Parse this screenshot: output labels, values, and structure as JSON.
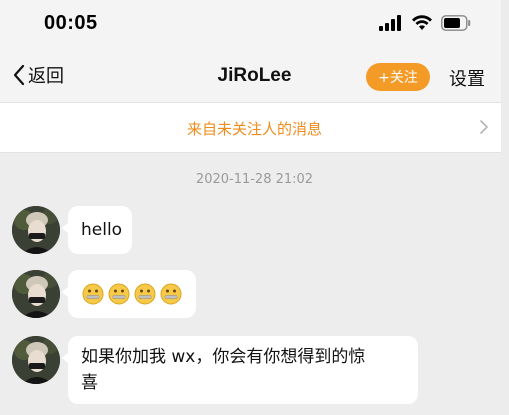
{
  "status_bar": {
    "time": "00:05",
    "icons": [
      "signal-icon",
      "wifi-icon",
      "battery-icon"
    ]
  },
  "nav": {
    "back_label": "返回",
    "title": "JiRoLee",
    "follow_label": "+关注",
    "settings_label": "设置"
  },
  "notice": {
    "text": "来自未关注人的消息"
  },
  "chat": {
    "timestamp": "2020-11-28 21:02",
    "messages": [
      {
        "type": "text",
        "text": "hello"
      },
      {
        "type": "emoji",
        "emoji_name": "zipper-mouth-face-icon",
        "count": 4
      },
      {
        "type": "text",
        "line1": "如果你加我 wx，你会有你想得到的惊",
        "line2": "喜"
      }
    ]
  },
  "colors": {
    "accent_orange": "#f49b27",
    "notice_text": "#f08c1c",
    "background": "#ededed",
    "bubble": "#ffffff"
  }
}
